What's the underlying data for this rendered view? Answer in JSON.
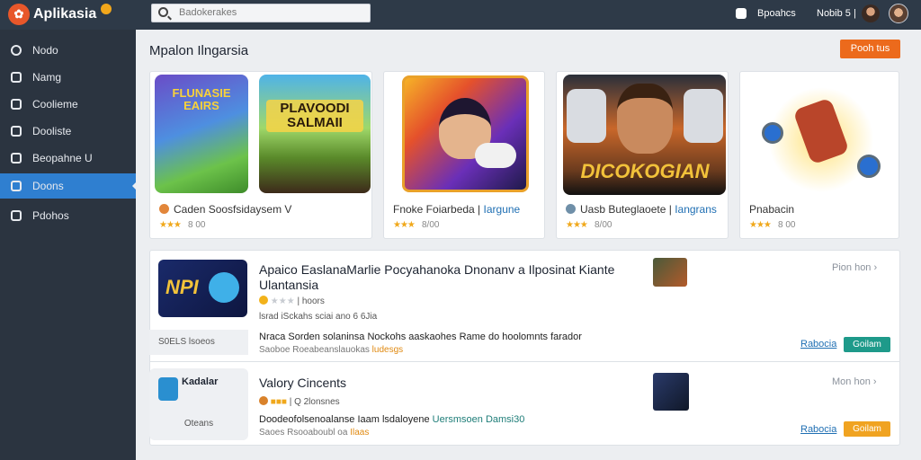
{
  "app": {
    "logo_glyph": "✿",
    "title": "Aplikasia"
  },
  "search": {
    "placeholder": "Badokerakes"
  },
  "header": {
    "item_a": "Bpoahcs",
    "item_b": "Nobib 5 |"
  },
  "sidebar": {
    "items": [
      {
        "label": "Nodo"
      },
      {
        "label": "Namg"
      },
      {
        "label": "Coolieme"
      },
      {
        "label": "Dooliste"
      },
      {
        "label": "Beopahne U"
      },
      {
        "label": "Doons",
        "active": true
      },
      {
        "label": "Pdohos"
      }
    ]
  },
  "main": {
    "title": "Mpalon Ilngarsia",
    "primary_button": "Pooh tus",
    "cards": [
      {
        "title": "Caden Soosfsidaysem V",
        "rating": "8 00"
      },
      {
        "title_plain": "Fnoke Foiarbeda |",
        "title_accent": "Iargune",
        "rating": "8/00"
      },
      {
        "title_plain": "Uasb Buteglaoete |",
        "title_accent": "Iangrans",
        "rating": "8/00"
      },
      {
        "title": "Pnabacin",
        "rating": "8 00"
      }
    ],
    "thumb_captions": {
      "card1": "FLUNASIE EAIRS",
      "card2": "PLAVOODI SALMAII",
      "card4": "DICOKOGIAN"
    },
    "rows": [
      {
        "thumb_text": "NPI",
        "thumb_foot": "S0ELS  lsoeos",
        "title": "Apaico EaslanaMarlie Pocyahanoka Dnonanv a Ilposinat Kiante Ulantansia",
        "meta1": "| hoors",
        "meta2": "lsrad iSckahs sciai ano  6 6Jia",
        "desc": "Nraca Sorden solaninsa Nockohs aaskaohes Rame do hoolomnts farador",
        "sub_orange": "Saoboe",
        "sub_grey": "Roeabeanslauokas",
        "sub_orange_2": "ludesgs",
        "more": "Pion hon",
        "link": "Rabocia",
        "button": "Goilam"
      },
      {
        "thumb_text": "Kadalar",
        "thumb_foot": "Oteans",
        "title": "Valory Cincents",
        "meta1": "| Q  2lonsnes",
        "desc_plain": "Doodeofolsenoalanse Iaam lsdaloyene",
        "desc_accent": "Uersmsoen Damsi30",
        "sub_orange": "Saoes",
        "sub_grey": "Rsooaboubl oa",
        "sub_orange_2": "Ilaas",
        "more": "Mon hon",
        "link": "Rabocia",
        "button": "Goilam"
      }
    ]
  },
  "colors": {
    "topbar": "#2e3a48",
    "sidebar": "#2b3440",
    "active": "#2f7fd0",
    "accent_orange": "#ec6a1c",
    "teal": "#1e9a8a",
    "link": "#1f6fb3"
  },
  "icons": [
    "logo-icon",
    "search-icon",
    "notification-icon",
    "chevron-right-icon"
  ]
}
